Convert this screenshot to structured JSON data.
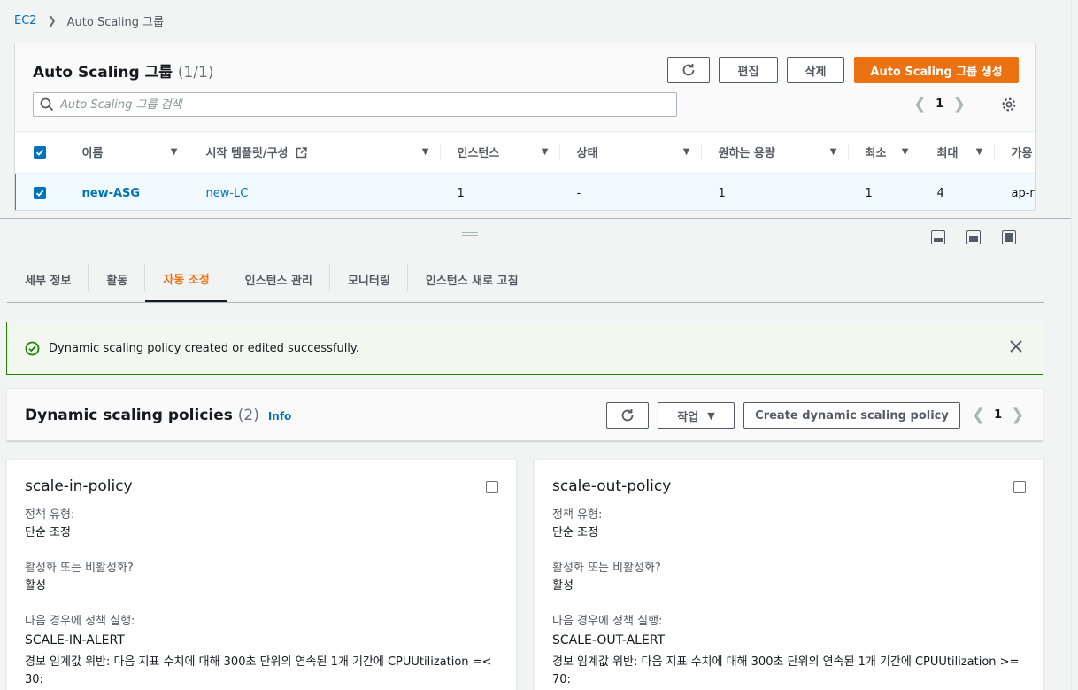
{
  "breadcrumb": {
    "root": "EC2",
    "current": "Auto Scaling 그룹"
  },
  "asg_panel": {
    "title": "Auto Scaling 그룹",
    "count": "(1/1)",
    "edit_label": "편집",
    "delete_label": "삭제",
    "create_label": "Auto Scaling 그룹 생성",
    "search_placeholder": "Auto Scaling 그룹 검색",
    "page": "1",
    "columns": [
      "이름",
      "시작 템플릿/구성",
      "인스턴스",
      "상태",
      "원하는 용량",
      "최소",
      "최대",
      "가용 영역"
    ],
    "row": {
      "name": "new-ASG",
      "launch": "new-LC",
      "instances": "1",
      "status": "-",
      "desired": "1",
      "min": "1",
      "max": "4",
      "az": "ap-n"
    }
  },
  "tabs": [
    "세부 정보",
    "활동",
    "자동 조정",
    "인스턴스 관리",
    "모니터링",
    "인스턴스 새로 고침"
  ],
  "active_tab": "자동 조정",
  "flash": {
    "message": "Dynamic scaling policy created or edited successfully."
  },
  "policies": {
    "title": "Dynamic scaling policies",
    "count": "(2)",
    "info": "Info",
    "actions_label": "작업",
    "create_label": "Create dynamic scaling policy",
    "page": "1",
    "labels": {
      "type": "정책 유형:",
      "enabled": "활성화 또는 비활성화?",
      "execute": "다음 경우에 정책 실행:"
    },
    "cards": [
      {
        "name": "scale-in-policy",
        "type": "단순 조정",
        "enabled": "활성",
        "alarm": "SCALE-IN-ALERT",
        "condition": "경보 임계값 위반: 다음 지표 수치에 대해 300초 단위의 연속된 1개 기간에 CPUUtilization =< 30:"
      },
      {
        "name": "scale-out-policy",
        "type": "단순 조정",
        "enabled": "활성",
        "alarm": "SCALE-OUT-ALERT",
        "condition": "경보 임계값 위반: 다음 지표 수치에 대해 300초 단위의 연속된 1개 기간에 CPUUtilization >= 70:"
      }
    ]
  },
  "colors": {
    "accent": "#ec7211",
    "link": "#0073bb",
    "success": "#1d8102"
  }
}
